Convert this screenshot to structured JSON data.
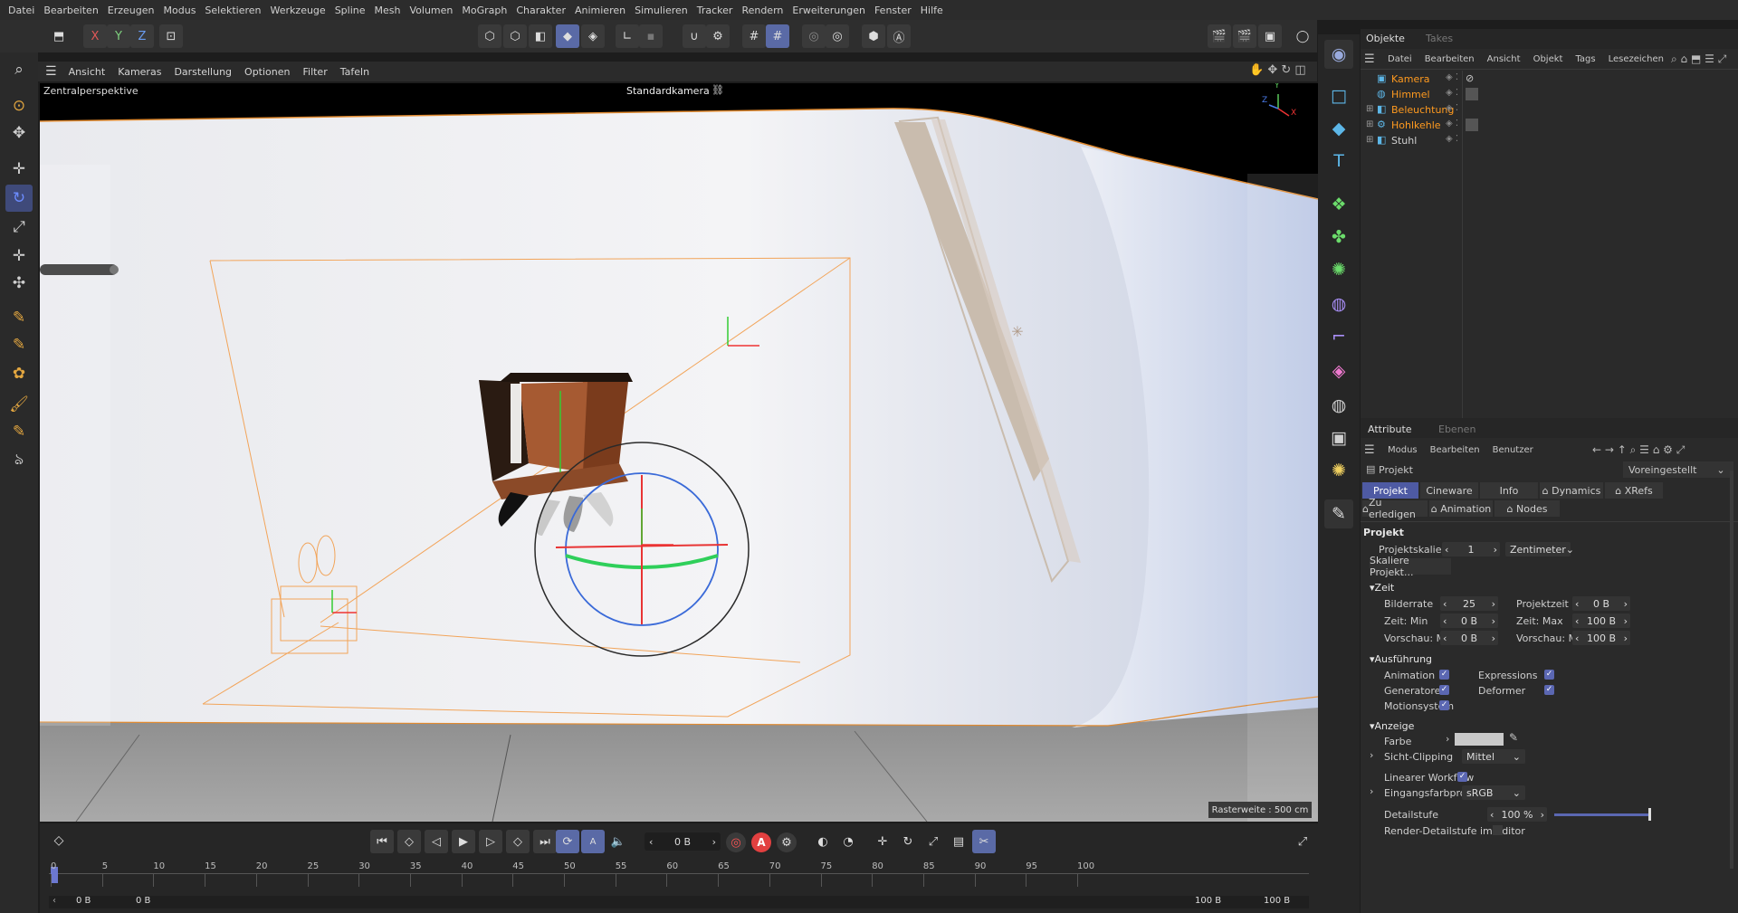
{
  "menubar": [
    "Datei",
    "Bearbeiten",
    "Erzeugen",
    "Modus",
    "Selektieren",
    "Werkzeuge",
    "Spline",
    "Mesh",
    "Volumen",
    "MoGraph",
    "Charakter",
    "Animieren",
    "Simulieren",
    "Tracker",
    "Rendern",
    "Erweiterungen",
    "Fenster",
    "Hilfe"
  ],
  "axis_buttons": {
    "x": "X",
    "y": "Y",
    "z": "Z"
  },
  "viewport": {
    "menu": [
      "Ansicht",
      "Kameras",
      "Darstellung",
      "Optionen",
      "Filter",
      "Tafeln"
    ],
    "perspective_label": "Zentralperspektive",
    "camera_label": "Standardkamera",
    "grid_label": "Rasterweite : 500 cm",
    "axis_y": "Y",
    "axis_z": "Z",
    "axis_x": "X"
  },
  "timeline": {
    "frame_field": "0 B",
    "ticks": [
      "0",
      "5",
      "10",
      "15",
      "20",
      "25",
      "30",
      "35",
      "40",
      "45",
      "50",
      "55",
      "60",
      "65",
      "70",
      "75",
      "80",
      "85",
      "90",
      "95",
      "100"
    ],
    "start_field": "0 B",
    "start_field2": "0 B",
    "end_field": "100 B",
    "end_field2": "100 B",
    "record_letter": "A",
    "key_letter": "A"
  },
  "objects": {
    "tabs": [
      "Objekte",
      "Takes"
    ],
    "menu": [
      "Datei",
      "Bearbeiten",
      "Ansicht",
      "Objekt",
      "Tags",
      "Lesezeichen"
    ],
    "items": [
      {
        "name": "Kamera",
        "color": "#ff9a1f"
      },
      {
        "name": "Himmel",
        "color": "#ff9a1f"
      },
      {
        "name": "Beleuchtung",
        "color": "#ff9a1f"
      },
      {
        "name": "Hohlkehle",
        "color": "#ff9a1f"
      },
      {
        "name": "Stuhl",
        "color": "#d0d0d0"
      }
    ]
  },
  "attributes": {
    "tabs": [
      "Attribute",
      "Ebenen"
    ],
    "menu": [
      "Modus",
      "Bearbeiten",
      "Benutzer"
    ],
    "mode_label": "Projekt",
    "preset": "Voreingestellt",
    "tabs_row1": [
      "Projekt",
      "Cineware",
      "Info",
      "Dynamics",
      "XRefs"
    ],
    "tabs_row2": [
      "Zu erledigen",
      "Animation",
      "Nodes"
    ],
    "section_title": "Projekt",
    "projektskalierung_label": "Projektskalierung",
    "projektskalierung_value": "1",
    "projektskalierung_unit": "Zentimeter",
    "skaliere_button": "Skaliere Projekt...",
    "zeit_section": "Zeit",
    "bilderrate_label": "Bilderrate",
    "bilderrate_value": "25",
    "projektzeit_label": "Projektzeit",
    "projektzeit_value": "0 B",
    "zeitmin_label": "Zeit: Min",
    "zeitmin_value": "0 B",
    "zeitmax_label": "Zeit: Max",
    "zeitmax_value": "100 B",
    "vorschaumin_label": "Vorschau: Min",
    "vorschaumin_value": "0 B",
    "vorschaumax_label": "Vorschau: Max",
    "vorschaumax_value": "100 B",
    "ausfuehrung_section": "Ausführung",
    "animation_label": "Animation",
    "expressions_label": "Expressions",
    "generatoren_label": "Generatoren",
    "deformer_label": "Deformer",
    "motionsystem_label": "Motionsystem",
    "anzeige_section": "Anzeige",
    "farbe_label": "Farbe",
    "sichtclipping_label": "Sicht-Clipping",
    "sichtclipping_value": "Mittel",
    "linearer_label": "Linearer Workflow",
    "eingangsfarbprofil_label": "Eingangsfarbprofil",
    "eingangsfarbprofil_value": "sRGB",
    "detailstufe_label": "Detailstufe",
    "detailstufe_value": "100 %",
    "render_detail_label": "Render-Detailstufe im Editor"
  },
  "accent": "#5b67b2"
}
